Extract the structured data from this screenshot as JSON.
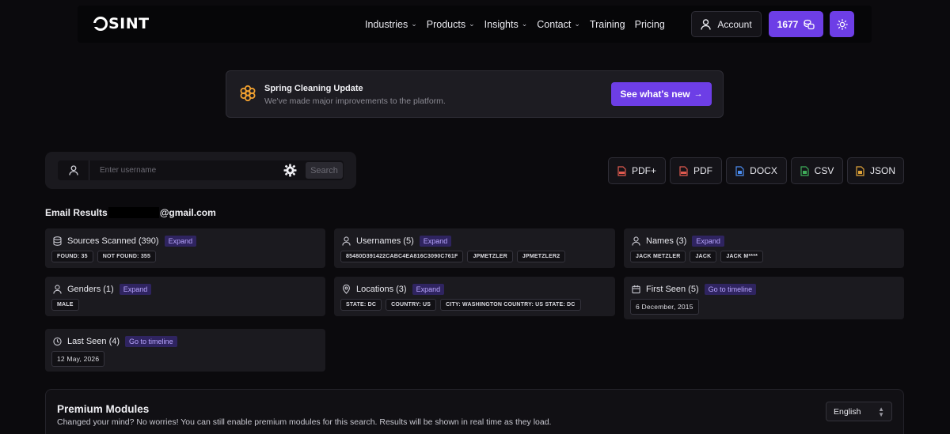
{
  "nav": {
    "logo": "SINT",
    "links": [
      {
        "label": "Industries",
        "has_menu": true
      },
      {
        "label": "Products",
        "has_menu": true
      },
      {
        "label": "Insights",
        "has_menu": true
      },
      {
        "label": "Contact",
        "has_menu": true
      },
      {
        "label": "Training",
        "has_menu": false
      },
      {
        "label": "Pricing",
        "has_menu": false
      }
    ],
    "account_label": "Account",
    "credits": "1677",
    "accent": "#6d3ee6"
  },
  "banner": {
    "title": "Spring Cleaning Update",
    "subtitle": "We've made major improvements to the platform.",
    "button_label": "See what's new",
    "icon": "flower-icon"
  },
  "search": {
    "placeholder": "Enter username",
    "button_label": "Search"
  },
  "exports": [
    {
      "label": "PDF+",
      "icon": "pdf-file-icon",
      "color": "#e05a4f"
    },
    {
      "label": "PDF",
      "icon": "pdf-file-icon",
      "color": "#e05a4f"
    },
    {
      "label": "DOCX",
      "icon": "docx-file-icon",
      "color": "#4c8df0"
    },
    {
      "label": "CSV",
      "icon": "csv-file-icon",
      "color": "#3fae5a"
    },
    {
      "label": "JSON",
      "icon": "json-file-icon",
      "color": "#e0a43a"
    }
  ],
  "results": {
    "title_prefix": "Email Results",
    "title_suffix": "@gmail.com",
    "cards": [
      {
        "title": "Sources Scanned (390)",
        "tag": "Expand",
        "icon": "database-icon",
        "chips": [
          "FOUND: 35",
          "NOT FOUND: 355"
        ]
      },
      {
        "title": "Usernames (5)",
        "tag": "Expand",
        "icon": "user-icon",
        "chips": [
          "85480D391422CABC4EA816C3090C761F",
          "JPMETZLER",
          "JPMETZLER2"
        ]
      },
      {
        "title": "Names (3)",
        "tag": "Expand",
        "icon": "user-icon",
        "chips": [
          "JACK METZLER",
          "JACK",
          "JACK M****"
        ]
      },
      {
        "title": "Genders (1)",
        "tag": "Expand",
        "icon": "user-icon",
        "chips": [
          "MALE"
        ]
      },
      {
        "title": "Locations (3)",
        "tag": "Expand",
        "icon": "location-pin-icon",
        "chips": [
          "STATE: DC",
          "COUNTRY: US",
          "CITY: WASHINGTON COUNTRY: US STATE: DC"
        ]
      },
      {
        "title": "First Seen (5)",
        "tag": "Go to timeline",
        "icon": "calendar-icon",
        "chips": [
          "6 December, 2015"
        ]
      },
      {
        "title": "Last Seen (4)",
        "tag": "Go to timeline",
        "icon": "clock-icon",
        "chips": [
          "12 May, 2026"
        ]
      }
    ]
  },
  "premium": {
    "title": "Premium Modules",
    "subtitle": "Changed your mind? No worries! You can still enable premium modules for this search. Results will be shown in real time as they load.",
    "language": "English"
  }
}
